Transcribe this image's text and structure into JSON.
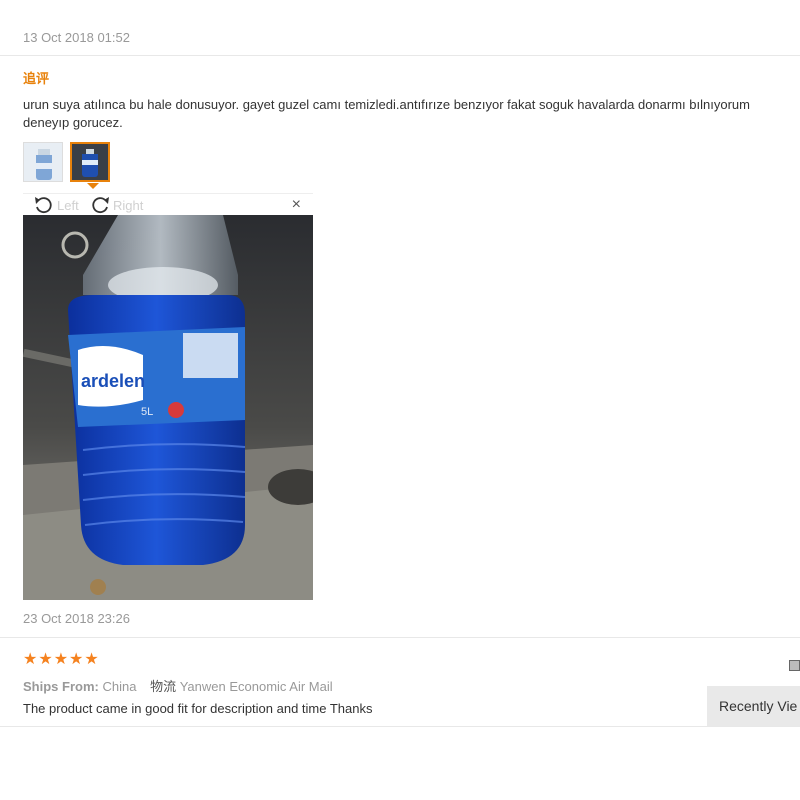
{
  "review1": {
    "date": "13 Oct 2018 01:52",
    "followup_label": "追评",
    "text": "urun suya atılınca bu hale donusuyor. gayet guzel camı temizledi.antıfırıze benzıyor fakat soguk havalarda donarmı bılnıyorum deneyıp gorucez.",
    "thumbnails": [
      {
        "icon": "bottle-photo-thumbnail"
      },
      {
        "icon": "bottle-photo-thumbnail-selected"
      }
    ],
    "viewer": {
      "rotate_left_label": "Left",
      "rotate_right_label": "Right",
      "close_label": "×",
      "photo_bottle_brand": "ardelen",
      "photo_bottle_volume": "5L"
    },
    "followup_date": "23 Oct 2018 23:26"
  },
  "review2": {
    "rating": 5,
    "stars": [
      "★",
      "★",
      "★",
      "★",
      "★"
    ],
    "ships_from_label": "Ships From:",
    "ships_from_value": "China",
    "logistics_label": "物流",
    "logistics_value": "Yanwen Economic Air Mail",
    "text": "The product came in good fit for description and time Thanks"
  },
  "recently_viewed_label": "Recently Vie",
  "colors": {
    "accent_orange": "#e8820c",
    "star": "#f5821f",
    "muted": "#999999"
  }
}
